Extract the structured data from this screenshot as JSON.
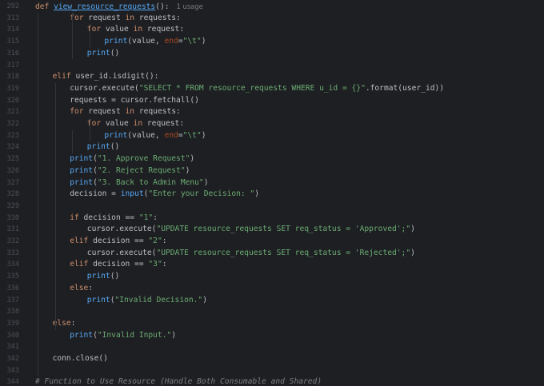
{
  "editor": {
    "usage_hint": "1 usage",
    "lines": [
      {
        "n": "292",
        "indent": 0,
        "tokens": [
          [
            "kw",
            "def "
          ],
          [
            "fnname",
            "view_resource_requests"
          ],
          [
            "p",
            "():"
          ],
          [
            "usage",
            "1 usage"
          ]
        ]
      },
      {
        "n": "313",
        "indent": 2,
        "tokens": [
          [
            "kw",
            "for "
          ],
          [
            "p",
            "request "
          ],
          [
            "kw",
            "in "
          ],
          [
            "p",
            "requests:"
          ]
        ]
      },
      {
        "n": "314",
        "indent": 3,
        "tokens": [
          [
            "kw",
            "for "
          ],
          [
            "p",
            "value "
          ],
          [
            "kw",
            "in "
          ],
          [
            "p",
            "request:"
          ]
        ]
      },
      {
        "n": "315",
        "indent": 4,
        "tokens": [
          [
            "bi",
            "print"
          ],
          [
            "p",
            "(value, "
          ],
          [
            "kwarg",
            "end"
          ],
          [
            "p",
            "="
          ],
          [
            "str",
            "\"\\t\""
          ],
          [
            "p",
            ")"
          ]
        ]
      },
      {
        "n": "316",
        "indent": 3,
        "tokens": [
          [
            "bi",
            "print"
          ],
          [
            "p",
            "()"
          ]
        ]
      },
      {
        "n": "317",
        "indent": 0,
        "tokens": []
      },
      {
        "n": "318",
        "indent": 1,
        "tokens": [
          [
            "kw",
            "elif "
          ],
          [
            "p",
            "user_id.isdigit():"
          ]
        ]
      },
      {
        "n": "319",
        "indent": 2,
        "tokens": [
          [
            "p",
            "cursor.execute("
          ],
          [
            "str",
            "\"SELECT * FROM resource_requests WHERE u_id = {}\""
          ],
          [
            "p",
            ".format(user_id))"
          ]
        ]
      },
      {
        "n": "320",
        "indent": 2,
        "tokens": [
          [
            "p",
            "requests = cursor.fetchall()"
          ]
        ]
      },
      {
        "n": "321",
        "indent": 2,
        "tokens": [
          [
            "kw",
            "for "
          ],
          [
            "p",
            "request "
          ],
          [
            "kw",
            "in "
          ],
          [
            "p",
            "requests:"
          ]
        ]
      },
      {
        "n": "322",
        "indent": 3,
        "tokens": [
          [
            "kw",
            "for "
          ],
          [
            "p",
            "value "
          ],
          [
            "kw",
            "in "
          ],
          [
            "p",
            "request:"
          ]
        ]
      },
      {
        "n": "323",
        "indent": 4,
        "tokens": [
          [
            "bi",
            "print"
          ],
          [
            "p",
            "(value, "
          ],
          [
            "kwarg",
            "end"
          ],
          [
            "p",
            "="
          ],
          [
            "str",
            "\"\\t\""
          ],
          [
            "p",
            ")"
          ]
        ]
      },
      {
        "n": "324",
        "indent": 3,
        "tokens": [
          [
            "bi",
            "print"
          ],
          [
            "p",
            "()"
          ]
        ]
      },
      {
        "n": "325",
        "indent": 2,
        "tokens": [
          [
            "bi",
            "print"
          ],
          [
            "p",
            "("
          ],
          [
            "str",
            "\"1. Approve Request\""
          ],
          [
            "p",
            ")"
          ]
        ]
      },
      {
        "n": "326",
        "indent": 2,
        "tokens": [
          [
            "bi",
            "print"
          ],
          [
            "p",
            "("
          ],
          [
            "str",
            "\"2. Reject Request\""
          ],
          [
            "p",
            ")"
          ]
        ]
      },
      {
        "n": "327",
        "indent": 2,
        "tokens": [
          [
            "bi",
            "print"
          ],
          [
            "p",
            "("
          ],
          [
            "str",
            "\"3. Back to Admin Menu\""
          ],
          [
            "p",
            ")"
          ]
        ]
      },
      {
        "n": "328",
        "indent": 2,
        "tokens": [
          [
            "p",
            "decision = "
          ],
          [
            "bi",
            "input"
          ],
          [
            "p",
            "("
          ],
          [
            "str",
            "\"Enter your Decision: \""
          ],
          [
            "p",
            ")"
          ]
        ]
      },
      {
        "n": "329",
        "indent": 0,
        "tokens": []
      },
      {
        "n": "330",
        "indent": 2,
        "tokens": [
          [
            "kw",
            "if "
          ],
          [
            "p",
            "decision == "
          ],
          [
            "str",
            "\"1\""
          ],
          [
            "p",
            ":"
          ]
        ]
      },
      {
        "n": "331",
        "indent": 3,
        "tokens": [
          [
            "p",
            "cursor.execute("
          ],
          [
            "str",
            "\"UPDATE resource_requests SET req_status = 'Approved';\""
          ],
          [
            "p",
            ")"
          ]
        ]
      },
      {
        "n": "332",
        "indent": 2,
        "tokens": [
          [
            "kw",
            "elif "
          ],
          [
            "p",
            "decision == "
          ],
          [
            "str",
            "\"2\""
          ],
          [
            "p",
            ":"
          ]
        ]
      },
      {
        "n": "333",
        "indent": 3,
        "tokens": [
          [
            "p",
            "cursor.execute("
          ],
          [
            "str",
            "\"UPDATE resource_requests SET req_status = 'Rejected';\""
          ],
          [
            "p",
            ")"
          ]
        ]
      },
      {
        "n": "334",
        "indent": 2,
        "tokens": [
          [
            "kw",
            "elif "
          ],
          [
            "p",
            "decision == "
          ],
          [
            "str",
            "\"3\""
          ],
          [
            "p",
            ":"
          ]
        ]
      },
      {
        "n": "335",
        "indent": 3,
        "tokens": [
          [
            "bi",
            "print"
          ],
          [
            "p",
            "()"
          ]
        ]
      },
      {
        "n": "336",
        "indent": 2,
        "tokens": [
          [
            "kw",
            "else"
          ],
          [
            "p",
            ":"
          ]
        ]
      },
      {
        "n": "337",
        "indent": 3,
        "tokens": [
          [
            "bi",
            "print"
          ],
          [
            "p",
            "("
          ],
          [
            "str",
            "\"Invalid Decision.\""
          ],
          [
            "p",
            ")"
          ]
        ]
      },
      {
        "n": "338",
        "indent": 0,
        "tokens": []
      },
      {
        "n": "339",
        "indent": 1,
        "tokens": [
          [
            "kw",
            "else"
          ],
          [
            "p",
            ":"
          ]
        ]
      },
      {
        "n": "340",
        "indent": 2,
        "tokens": [
          [
            "bi",
            "print"
          ],
          [
            "p",
            "("
          ],
          [
            "str",
            "\"Invalid Input.\""
          ],
          [
            "p",
            ")"
          ]
        ]
      },
      {
        "n": "341",
        "indent": 0,
        "tokens": []
      },
      {
        "n": "342",
        "indent": 1,
        "tokens": [
          [
            "p",
            "conn.close()"
          ]
        ]
      },
      {
        "n": "343",
        "indent": 0,
        "tokens": []
      },
      {
        "n": "344",
        "indent": 0,
        "tokens": [
          [
            "cm",
            "# Function to Use Resource (Handle Both Consumable and Shared)"
          ]
        ]
      }
    ]
  },
  "colors": {
    "background": "#1e1f22",
    "keyword": "#cf8e6d",
    "function": "#56a8f5",
    "string": "#6aab73",
    "builtin": "#8888c6",
    "comment": "#7a7e85",
    "line_number": "#4b5059"
  }
}
